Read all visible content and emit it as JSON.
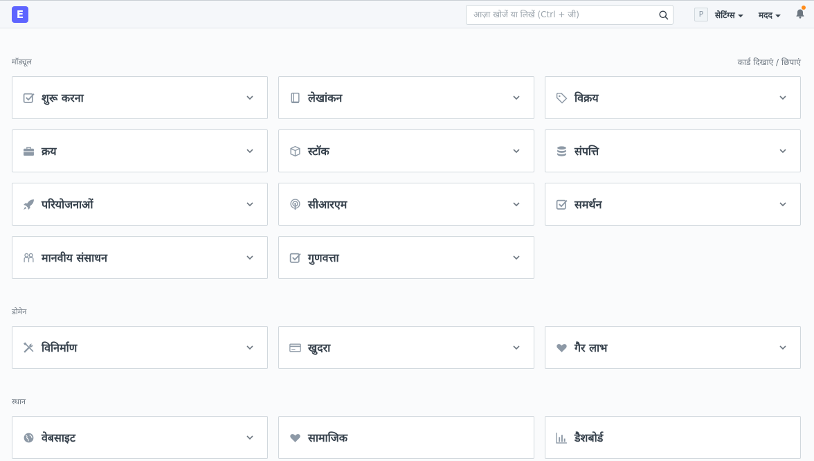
{
  "navbar": {
    "logo_letter": "E",
    "search_placeholder": "आज़ा खोजें या लिखें (Ctrl + जी)",
    "avatar_letter": "P",
    "settings_label": "सेटिंग्स",
    "help_label": "मदद"
  },
  "sections": {
    "modules_label": "मॉड्यूल",
    "toggle_cards_label": "कार्ड दिखाएं / छिपाएं",
    "domains_label": "डोमेन",
    "places_label": "स्थान"
  },
  "modules": [
    {
      "label": "शुरू करना",
      "icon": "checkbox-icon"
    },
    {
      "label": "लेखांकन",
      "icon": "book-icon"
    },
    {
      "label": "विक्रय",
      "icon": "tag-icon"
    },
    {
      "label": "क्रय",
      "icon": "briefcase-icon"
    },
    {
      "label": "स्टॉक",
      "icon": "box-icon"
    },
    {
      "label": "संपत्ति",
      "icon": "database-icon"
    },
    {
      "label": "परियोजनाओं",
      "icon": "rocket-icon"
    },
    {
      "label": "सीआरएम",
      "icon": "broadcast-icon"
    },
    {
      "label": "समर्थन",
      "icon": "checkbox-icon"
    },
    {
      "label": "मानवीय संसाधन",
      "icon": "people-icon"
    },
    {
      "label": "गुणवत्ता",
      "icon": "checkbox-icon"
    }
  ],
  "domains": [
    {
      "label": "विनिर्माण",
      "icon": "tools-icon"
    },
    {
      "label": "खुदरा",
      "icon": "credit-card-icon"
    },
    {
      "label": "गैर लाभ",
      "icon": "heart-icon"
    }
  ],
  "places": [
    {
      "label": "वेबसाइट",
      "icon": "globe-icon"
    },
    {
      "label": "सामाजिक",
      "icon": "heart-icon"
    },
    {
      "label": "डैशबोर्ड",
      "icon": "bar-chart-icon"
    }
  ],
  "colors": {
    "brand": "#5e64ff",
    "notification": "#ff8c1a",
    "icon": "#8d99a6"
  }
}
